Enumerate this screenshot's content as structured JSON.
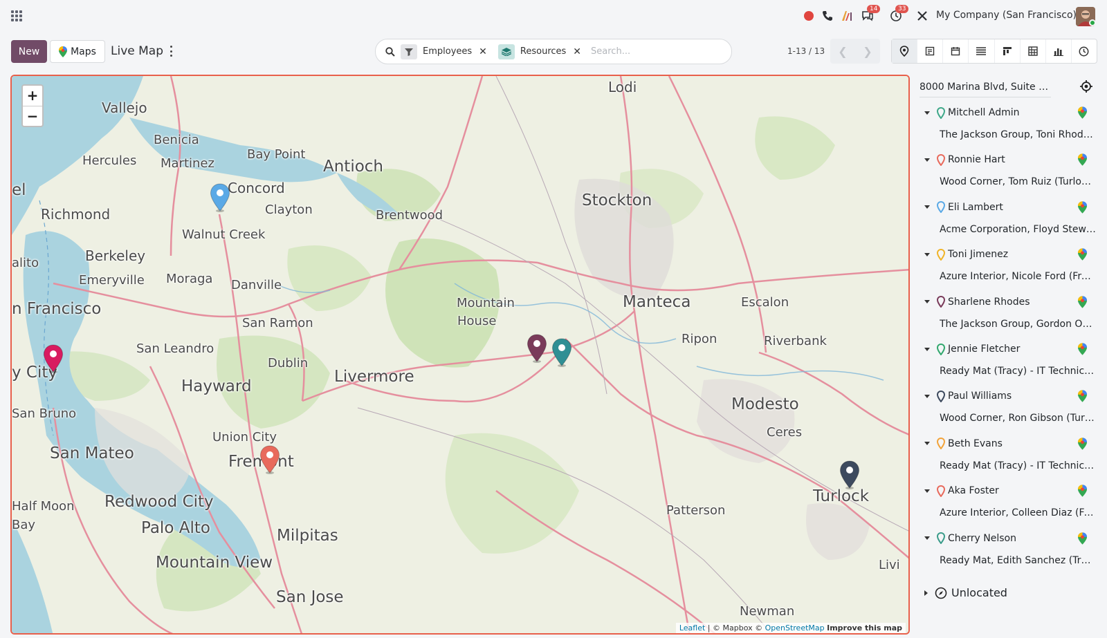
{
  "navbar": {
    "company": "My Company (San Francisco)",
    "messages_badge": "14",
    "activities_badge": "33"
  },
  "control": {
    "new_label": "New",
    "maps_label": "Maps",
    "current_view": "Live Map",
    "facets": [
      {
        "label": "Employees",
        "icon": "filter-icon",
        "color": "#e4e5e8"
      },
      {
        "label": "Resources",
        "icon": "layers-icon",
        "color": "#c7e4e1"
      }
    ],
    "search_placeholder": "Search...",
    "pager": "1-13 / 13"
  },
  "map": {
    "zoom_in": "+",
    "zoom_out": "−",
    "attribution_leaflet": "Leaflet",
    "attribution_mapbox": "| © Mapbox ©",
    "attribution_osm": "OpenStreetMap",
    "attribution_improve": "Improve this map",
    "places": [
      "Lodi",
      "Vallejo",
      "Benicia",
      "Hercules",
      "Martinez",
      "Bay Point",
      "Antioch",
      "Concord",
      "Clayton",
      "Richmond",
      "Walnut Creek",
      "Brentwood",
      "Stockton",
      "Berkeley",
      "Emeryville",
      "Moraga",
      "Danville",
      "Mountain",
      "House",
      "Manteca",
      "Escalon",
      "n Francisco",
      "San Ramon",
      "San Leandro",
      "Ripon",
      "Riverbank",
      "Dublin",
      "Livermore",
      "Hayward",
      "y City",
      "Modesto",
      "San Bruno",
      "Union City",
      "Ceres",
      "San Mateo",
      "Fremont",
      "Redwood City",
      "Palo Alto",
      "Turlock",
      "Half Moon",
      "Bay",
      "Patterson",
      "Milpitas",
      "Mountain View",
      "San Jose",
      "Newman",
      "el",
      "alito",
      "Livi"
    ]
  },
  "sidebar": {
    "origin": "8000 Marina Blvd, Suite 3...",
    "employees": [
      {
        "name": "Mitchell Admin",
        "detail": "The Jackson Group, Toni Rhode...",
        "color": "#3fa889"
      },
      {
        "name": "Ronnie Hart",
        "detail": "Wood Corner, Tom Ruiz (Turlock...",
        "color": "#e86a5c"
      },
      {
        "name": "Eli Lambert",
        "detail": "Acme Corporation, Floyd Stewar...",
        "color": "#5aa9e6"
      },
      {
        "name": "Toni Jimenez",
        "detail": "Azure Interior, Nicole Ford (Frem...",
        "color": "#f0b429"
      },
      {
        "name": "Sharlene Rhodes",
        "detail": "The Jackson Group, Gordon Ow...",
        "color": "#7a3b5a"
      },
      {
        "name": "Jennie Fletcher",
        "detail": "Ready Mat (Tracy) - IT Technician",
        "color": "#33a86e"
      },
      {
        "name": "Paul Williams",
        "detail": "Wood Corner, Ron Gibson (Turlo...",
        "color": "#3d4a5e"
      },
      {
        "name": "Beth Evans",
        "detail": "Ready Mat (Tracy) - IT Technician",
        "color": "#f2a33a"
      },
      {
        "name": "Aka Foster",
        "detail": "Azure Interior, Colleen Diaz (Fre...",
        "color": "#e86a5c"
      },
      {
        "name": "Cherry Nelson",
        "detail": "Ready Mat, Edith Sanchez (Trac...",
        "color": "#3a9c8a"
      }
    ],
    "unlocated_label": "Unlocated"
  },
  "markers": [
    {
      "color": "#5aa9e6"
    },
    {
      "color": "#d81b60"
    },
    {
      "color": "#7a3b5a"
    },
    {
      "color": "#2f8f94"
    },
    {
      "color": "#e86a5c"
    },
    {
      "color": "#3d4a5e"
    }
  ]
}
